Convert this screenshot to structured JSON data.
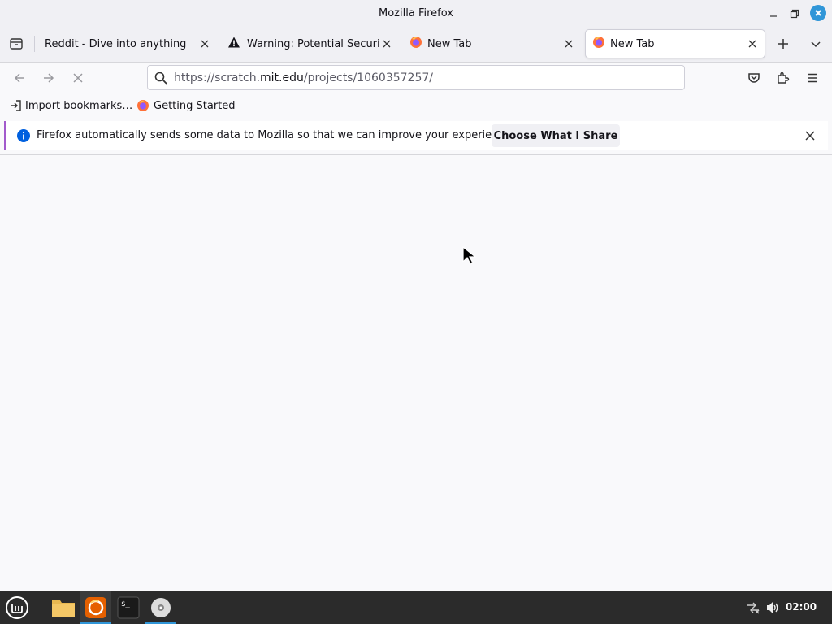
{
  "window": {
    "title": "Mozilla Firefox"
  },
  "tabs": [
    {
      "label": "Reddit - Dive into anything",
      "icon": "reddit-favicon"
    },
    {
      "label": "Warning: Potential Security",
      "icon": "warning-icon"
    },
    {
      "label": "New Tab",
      "icon": "firefox-icon"
    },
    {
      "label": "New Tab",
      "icon": "firefox-icon",
      "active": true
    }
  ],
  "navbar": {
    "url_prefix": "https://scratch.",
    "url_host": "mit.edu",
    "url_path": "/projects/1060357257/"
  },
  "bookmarks": [
    {
      "label": "Import bookmarks…",
      "icon": "import-icon"
    },
    {
      "label": "Getting Started",
      "icon": "firefox-icon"
    }
  ],
  "notification": {
    "message": "Firefox automatically sends some data to Mozilla so that we can improve your experience.",
    "button_label": "Choose What I Share"
  },
  "taskbar": {
    "clock": "02:00",
    "apps": [
      "menu-icon",
      "files-icon",
      "firefox-icon",
      "terminal-icon",
      "disc-icon"
    ]
  },
  "colors": {
    "accent": "#3096d8",
    "notification_bar": "#a25acc",
    "taskbar": "#2b2b2b"
  }
}
